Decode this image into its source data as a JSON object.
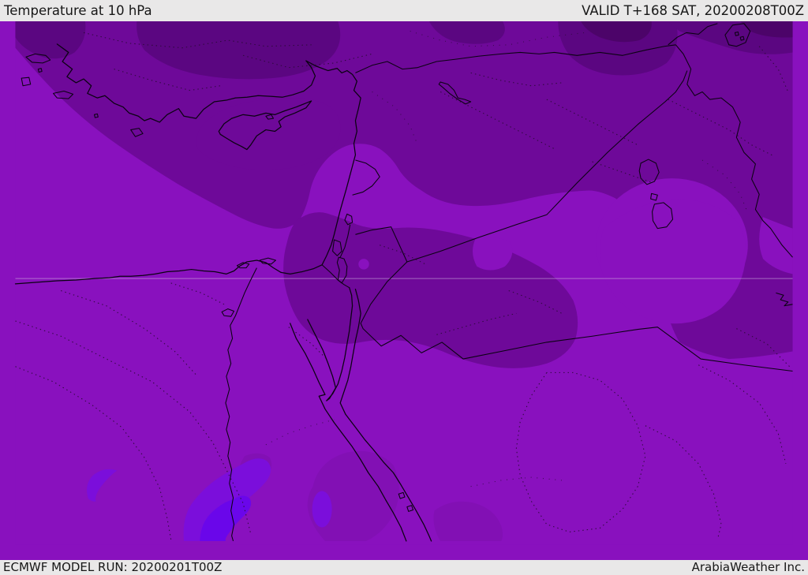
{
  "header": {
    "title": "Temperature at 10 hPa",
    "valid": "VALID T+168 SAT, 20200208T00Z"
  },
  "footer": {
    "model_run": "ECMWF MODEL RUN: 20200201T00Z",
    "credit": "ArabiaWeather Inc."
  },
  "map": {
    "description": "Filled temperature contour map of the Eastern Mediterranean / Middle East in purple shades",
    "colors": {
      "base": "#8911be",
      "light": "#9c2bd0",
      "middark": "#6e0999",
      "dark": "#5b0681",
      "darkest": "#4c0469",
      "cold_outer": "#7b0edb",
      "cold_core": "#6a06ea",
      "south_soft": "#7c10ac",
      "graticule": "#d2b8e0",
      "line": "#0b0212",
      "bar_bg": "#e9e8e8",
      "bar_text": "#171717"
    }
  }
}
